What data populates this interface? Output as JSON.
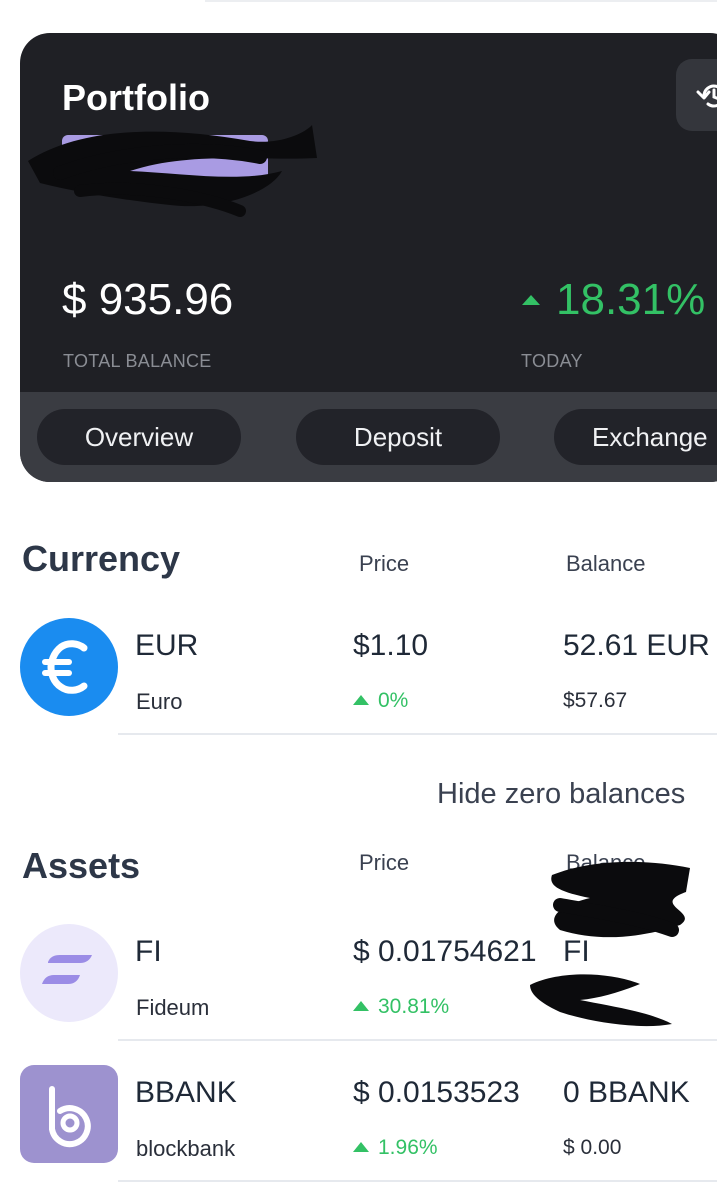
{
  "portfolio": {
    "title": "Portfolio",
    "total_balance": "$ 935.96",
    "total_balance_label": "TOTAL BALANCE",
    "today_change": "18.31%",
    "today_label": "TODAY",
    "history_icon": "history-icon"
  },
  "tabs": [
    {
      "label": "Overview"
    },
    {
      "label": "Deposit"
    },
    {
      "label": "Exchange"
    }
  ],
  "currency_section": {
    "title": "Currency",
    "price_header": "Price",
    "balance_header": "Balance",
    "items": [
      {
        "symbol": "EUR",
        "name": "Euro",
        "price": "$1.10",
        "change": "0%",
        "balance": "52.61 EUR",
        "balance_fiat": "$57.67",
        "icon": "euro-icon",
        "icon_color": "#1a8cf0"
      }
    ]
  },
  "hide_zero_label": "Hide zero balances",
  "assets_section": {
    "title": "Assets",
    "price_header": "Price",
    "balance_header": "Balance",
    "items": [
      {
        "symbol": "FI",
        "name": "Fideum",
        "price": "$ 0.01754621",
        "change": "30.81%",
        "balance": "FI",
        "icon": "fideum-icon"
      },
      {
        "symbol": "BBANK",
        "name": "blockbank",
        "price": "$ 0.0153523",
        "change": "1.96%",
        "balance": "0 BBANK",
        "balance_fiat": "$ 0.00",
        "icon": "blockbank-icon",
        "icon_color": "#9d92cf"
      }
    ]
  },
  "colors": {
    "card_bg": "#1f2025",
    "tabs_bar_bg": "#3a3c42",
    "positive": "#33c165"
  }
}
